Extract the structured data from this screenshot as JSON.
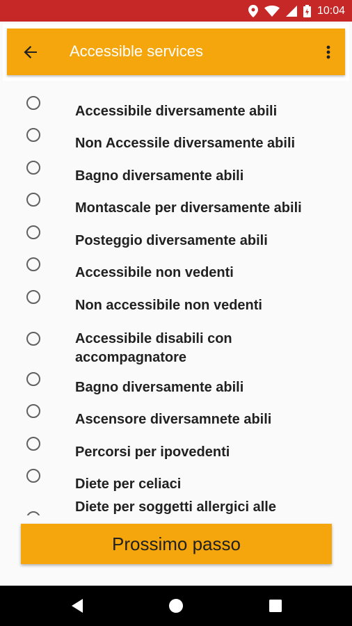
{
  "status_bar": {
    "time": "10:04",
    "icons": [
      "location-icon",
      "wifi-icon",
      "signal-icon",
      "battery-icon"
    ],
    "color": "#c62828"
  },
  "toolbar": {
    "title": "Accessible services",
    "back_icon": "arrow-back-icon",
    "menu_icon": "more-vert-icon",
    "color": "#f5a60d"
  },
  "options": [
    {
      "label": "Accessibile diversamente abili",
      "checked": false
    },
    {
      "label": "Non Accessile diversamente abili",
      "checked": false
    },
    {
      "label": "Bagno diversamente abili",
      "checked": false
    },
    {
      "label": "Montascale per diversamente abili",
      "checked": false
    },
    {
      "label": "Posteggio diversamente abili",
      "checked": false
    },
    {
      "label": "Accessibile non vedenti",
      "checked": false
    },
    {
      "label": "Non accessibile non vedenti",
      "checked": false
    },
    {
      "label": "Accessibile disabili con accompagnatore",
      "checked": false
    },
    {
      "label": "Bagno diversamente abili",
      "checked": false
    },
    {
      "label": "Ascensore diversamnete abili",
      "checked": false
    },
    {
      "label": "Percorsi per ipovedenti",
      "checked": false
    },
    {
      "label": "Diete per celiaci",
      "checked": false
    },
    {
      "label": "Diete per soggetti allergici alle",
      "checked": false
    }
  ],
  "next_button": {
    "label": "Prossimo passo",
    "color": "#f5a60d"
  },
  "nav_bar": {
    "icons": [
      "back-triangle-icon",
      "home-circle-icon",
      "recents-square-icon"
    ]
  }
}
